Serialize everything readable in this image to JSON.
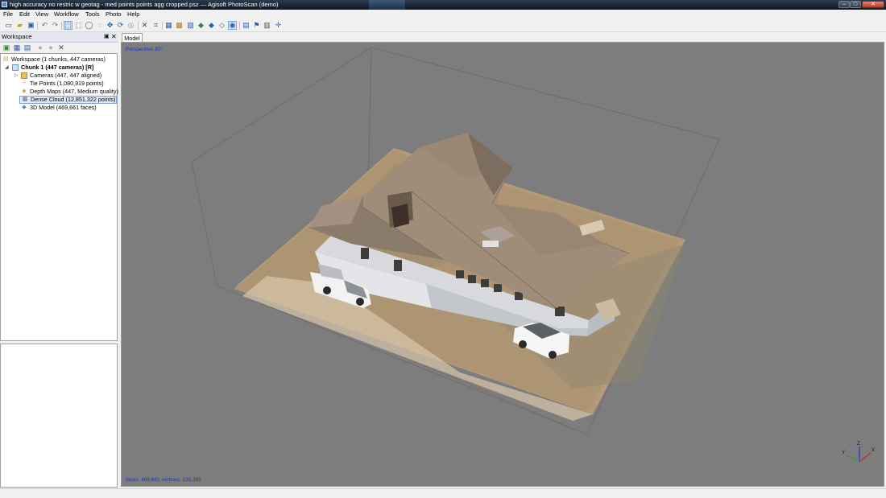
{
  "window": {
    "title": "high accuracy no restric w geotag - med points points agg cropped.psz — Agisoft PhotoScan (demo)",
    "min_glyph": "–",
    "max_glyph": "□",
    "close_glyph": "✕"
  },
  "menu": [
    "File",
    "Edit",
    "View",
    "Workflow",
    "Tools",
    "Photo",
    "Help"
  ],
  "workspace": {
    "title": "Workspace",
    "pin_glyph": "▣",
    "close_glyph": "✕",
    "tree": {
      "root": "Workspace (1 chunks, 447 cameras)",
      "chunk": "Chunk 1 (447 cameras) [R]",
      "items": [
        {
          "label": "Cameras (447, 447 aligned)",
          "icon": "folder-icon"
        },
        {
          "label": "Tie Points (1,080,919 points)",
          "icon": "tie-points-icon"
        },
        {
          "label": "Depth Maps (447, Medium quality)",
          "icon": "depth-maps-icon"
        },
        {
          "label": "Dense Cloud (12,851,322 points)",
          "icon": "dense-cloud-icon"
        },
        {
          "label": "3D Model (469,661 faces)",
          "icon": "model-icon"
        }
      ]
    }
  },
  "tabs": [
    "Model"
  ],
  "viewport": {
    "projection": "Perspective 30°",
    "status": "faces: 469,661 vertices: 235,385",
    "axes": {
      "x": "X",
      "y": "Y",
      "z": "Z"
    }
  },
  "colors": {
    "viewport_bg": "#7d7d7d",
    "overlay_text": "#1a33c8",
    "selection": "#dcebfb"
  }
}
